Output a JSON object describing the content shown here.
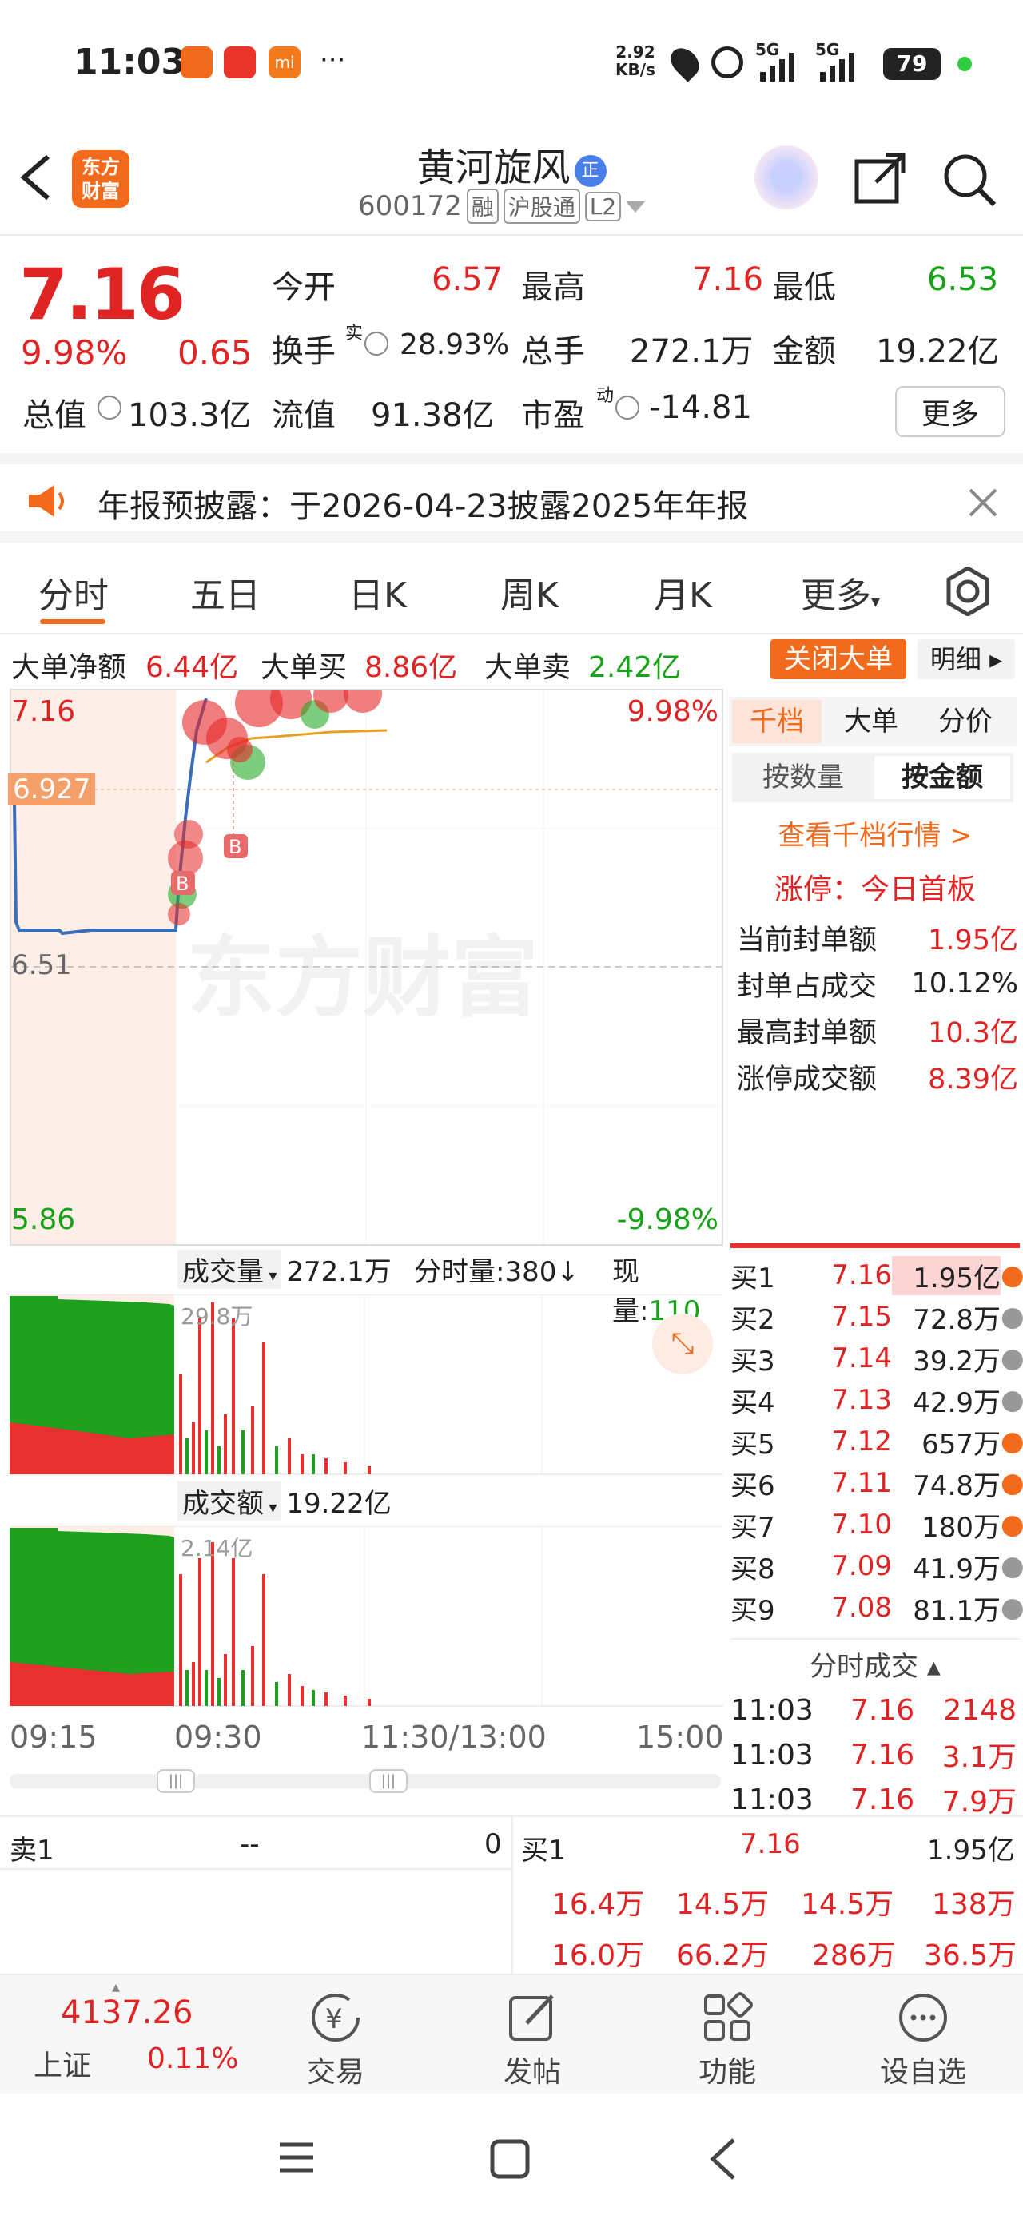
{
  "status_bar": {
    "time": "11:03",
    "net_speed_top": "2.92",
    "net_speed_bottom": "KB/s",
    "signal1": "5G",
    "signal2": "5G",
    "battery": "79",
    "more": "···"
  },
  "header": {
    "logo_line1": "东方",
    "logo_line2": "财富",
    "stock_name": "黄河旋风",
    "badge": "正",
    "code": "600172",
    "tag_margin": "融",
    "tag_connect": "沪股通",
    "tag_level": "L2"
  },
  "quote": {
    "price": "7.16",
    "change_pct": "9.98%",
    "change_amt": "0.65",
    "open_label": "今开",
    "open": "6.57",
    "high_label": "最高",
    "high": "7.16",
    "low_label": "最低",
    "low": "6.53",
    "turnover_label": "换手",
    "turnover_sup": "实",
    "turnover": "28.93%",
    "volume_label": "总手",
    "volume": "272.1万",
    "amount_label": "金额",
    "amount": "19.22亿",
    "mktcap_label": "总值",
    "mktcap": "103.3亿",
    "float_label": "流值",
    "float": "91.38亿",
    "pe_label": "市盈",
    "pe_sup": "动",
    "pe": "-14.81",
    "more_btn": "更多"
  },
  "notice": {
    "text": "年报预披露：于2026-04-23披露2025年年报"
  },
  "tabs": [
    "分时",
    "五日",
    "日K",
    "周K",
    "月K",
    "更多"
  ],
  "bigorder": {
    "net_label": "大单净额",
    "net": "6.44亿",
    "buy_label": "大单买",
    "buy": "8.86亿",
    "sell_label": "大单卖",
    "sell": "2.42亿",
    "close_btn": "关闭大单",
    "detail_btn": "明细"
  },
  "chart": {
    "top_price": "7.16",
    "top_pct": "9.98%",
    "avg_price": "6.927",
    "base_price": "6.51",
    "bottom_price": "5.86",
    "bottom_pct": "-9.98%",
    "watermark": "东方财富",
    "marker": "B"
  },
  "volume_panel": {
    "label": "成交量",
    "value": "272.1万",
    "tick_label": "分时量:380",
    "now_label": "现量:",
    "now_value": "110",
    "max": "29.8万"
  },
  "amount_panel": {
    "label": "成交额",
    "value": "19.22亿",
    "max": "2.14亿"
  },
  "time_axis": [
    "09:15",
    "09:30",
    "11:30/13:00",
    "15:00"
  ],
  "right_panel": {
    "tabs": [
      "千档",
      "大单",
      "分价"
    ],
    "mode_tabs": [
      "按数量",
      "按金额"
    ],
    "link": "查看千档行情 >",
    "limit_title": "涨停：今日首板",
    "stats": [
      {
        "label": "当前封单额",
        "value": "1.95亿"
      },
      {
        "label": "封单占成交",
        "value": "10.12%"
      },
      {
        "label": "最高封单额",
        "value": "10.3亿"
      },
      {
        "label": "涨停成交额",
        "value": "8.39亿"
      }
    ],
    "buys": [
      {
        "label": "买1",
        "price": "7.16",
        "vol": "1.95亿"
      },
      {
        "label": "买2",
        "price": "7.15",
        "vol": "72.8万"
      },
      {
        "label": "买3",
        "price": "7.14",
        "vol": "39.2万"
      },
      {
        "label": "买4",
        "price": "7.13",
        "vol": "42.9万"
      },
      {
        "label": "买5",
        "price": "7.12",
        "vol": "657万"
      },
      {
        "label": "买6",
        "price": "7.11",
        "vol": "74.8万"
      },
      {
        "label": "买7",
        "price": "7.10",
        "vol": "180万"
      },
      {
        "label": "买8",
        "price": "7.09",
        "vol": "41.9万"
      },
      {
        "label": "买9",
        "price": "7.08",
        "vol": "81.1万"
      }
    ],
    "trades_title": "分时成交",
    "trades": [
      {
        "time": "11:03",
        "price": "7.16",
        "vol": "2148"
      },
      {
        "time": "11:03",
        "price": "7.16",
        "vol": "3.1万"
      },
      {
        "time": "11:03",
        "price": "7.16",
        "vol": "7.9万"
      }
    ]
  },
  "sellbuy": {
    "sell_label": "卖1",
    "sell_price": "--",
    "sell_vol": "0",
    "buy_label": "买1",
    "buy_price": "7.16",
    "buy_vol": "1.95亿",
    "queue": [
      "16.4万",
      "14.5万",
      "14.5万",
      "138万",
      "16.0万",
      "66.2万",
      "286万",
      "36.5万"
    ]
  },
  "bottom_nav": {
    "index_value": "4137.26",
    "index_name": "上证",
    "index_pct": "0.11%",
    "items": [
      "交易",
      "发帖",
      "功能",
      "设自选"
    ]
  },
  "colors": {
    "up": "#e02424",
    "down": "#17a317",
    "accent": "#f26b1d"
  }
}
